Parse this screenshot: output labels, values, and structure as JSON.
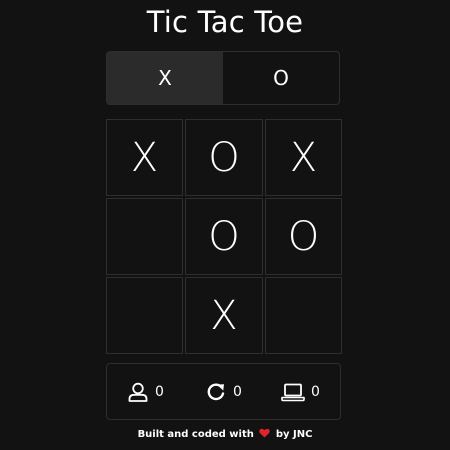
{
  "title": "Tic Tac Toe",
  "turn_switch": {
    "options": [
      "X",
      "O"
    ],
    "active": "X"
  },
  "board": {
    "cells": [
      "X",
      "O",
      "X",
      "",
      "O",
      "O",
      "",
      "X",
      ""
    ]
  },
  "scores": {
    "player": {
      "icon": "user-icon",
      "value": "0"
    },
    "draw": {
      "icon": "restart-icon",
      "value": "0"
    },
    "computer": {
      "icon": "laptop-icon",
      "value": "0"
    }
  },
  "footer": {
    "prefix": "Built and coded with",
    "icon": "heart-icon",
    "suffix": "by JNC"
  },
  "colors": {
    "background": "#121212",
    "border": "#2e2e2e",
    "active_tab": "#2b2b2b",
    "heart": "#e0242b",
    "text": "#ffffff"
  }
}
